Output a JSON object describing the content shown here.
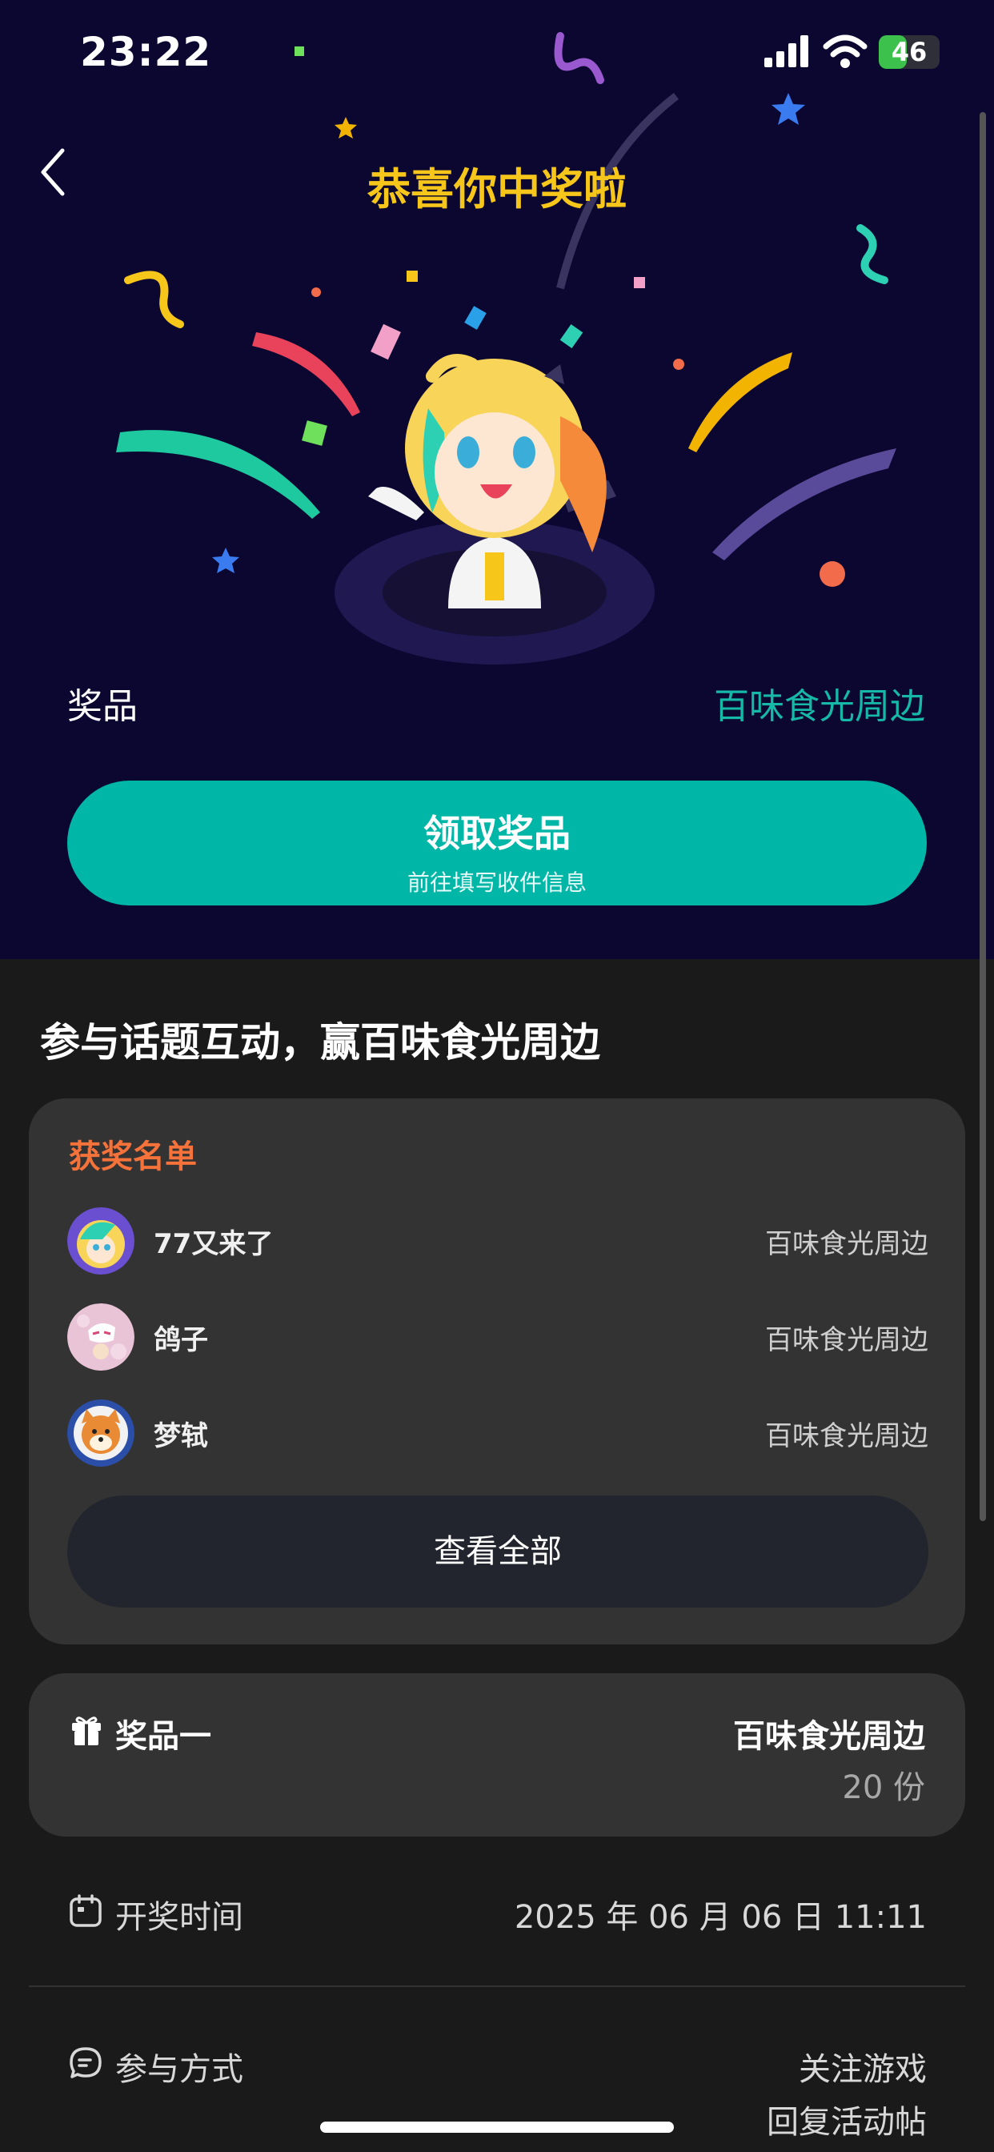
{
  "status_bar": {
    "time": "23:22",
    "battery": "46"
  },
  "header": {
    "title": "恭喜你中奖啦"
  },
  "prize": {
    "label": "奖品",
    "name": "百味食光周边"
  },
  "claim_button": {
    "label": "领取奖品",
    "sublabel": "前往填写收件信息"
  },
  "section": {
    "title": "参与话题互动，赢百味食光周边"
  },
  "winners": {
    "title": "获奖名单",
    "list": [
      {
        "name": "77又来了",
        "prize": "百味食光周边",
        "avatar": "anime-girl-avatar"
      },
      {
        "name": "鸽子",
        "prize": "百味食光周边",
        "avatar": "pink-character-avatar"
      },
      {
        "name": "梦轼",
        "prize": "百味食光周边",
        "avatar": "shiba-dog-avatar"
      }
    ],
    "view_all": "查看全部"
  },
  "prize_detail": {
    "label": "奖品一",
    "name": "百味食光周边",
    "count": "20 份",
    "icon": "gift-icon"
  },
  "draw_time": {
    "label": "开奖时间",
    "value": "2025 年 06 月 06 日 11:11",
    "icon": "calendar-icon"
  },
  "participation": {
    "label": "参与方式",
    "line1": "关注游戏",
    "line2": "回复活动帖",
    "icon": "chat-icon"
  },
  "colors": {
    "hero_bg": "#0b0730",
    "accent_teal": "#00b6a7",
    "title_yellow": "#f6c61a",
    "winners_orange": "#f5723a"
  }
}
